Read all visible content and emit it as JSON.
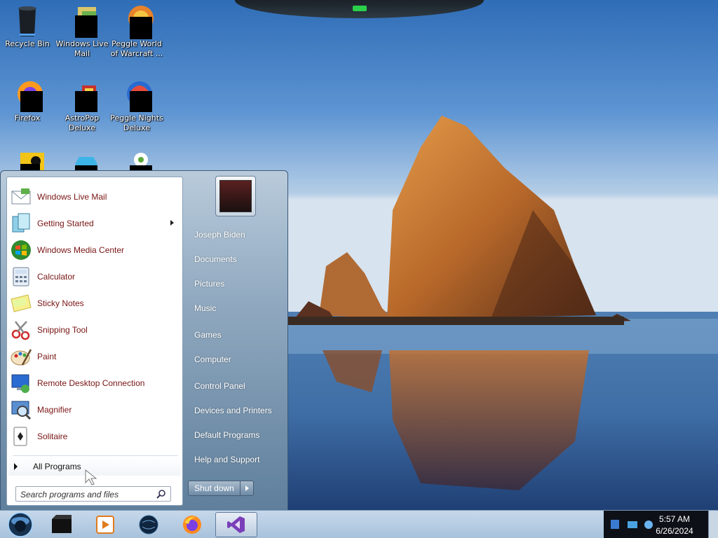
{
  "desktop": {
    "icons": [
      {
        "label": "Recycle Bin",
        "icon": "recycle-bin-icon"
      },
      {
        "label": "Windows Live Mail",
        "icon": "windows-live-mail-icon"
      },
      {
        "label": "Peggle World of Warcraft ...",
        "icon": "peggle-warcraft-icon"
      },
      {
        "label": "Firefox",
        "icon": "firefox-icon"
      },
      {
        "label": "AstroPop Deluxe",
        "icon": "astropop-icon"
      },
      {
        "label": "Peggle Nights Deluxe",
        "icon": "peggle-nights-icon"
      }
    ]
  },
  "start_menu": {
    "programs": [
      {
        "label": "Windows Live Mail",
        "icon": "mail-icon",
        "has_submenu": false
      },
      {
        "label": "Getting Started",
        "icon": "getting-started-icon",
        "has_submenu": true
      },
      {
        "label": "Windows Media Center",
        "icon": "media-center-icon",
        "has_submenu": false
      },
      {
        "label": "Calculator",
        "icon": "calculator-icon",
        "has_submenu": false
      },
      {
        "label": "Sticky Notes",
        "icon": "sticky-notes-icon",
        "has_submenu": false
      },
      {
        "label": "Snipping Tool",
        "icon": "snipping-tool-icon",
        "has_submenu": false
      },
      {
        "label": "Paint",
        "icon": "paint-icon",
        "has_submenu": false
      },
      {
        "label": "Remote Desktop Connection",
        "icon": "remote-desktop-icon",
        "has_submenu": false
      },
      {
        "label": "Magnifier",
        "icon": "magnifier-icon",
        "has_submenu": false
      },
      {
        "label": "Solitaire",
        "icon": "solitaire-icon",
        "has_submenu": false
      }
    ],
    "all_programs_label": "All Programs",
    "search_placeholder": "Search programs and files",
    "right_items": [
      "Joseph Biden",
      "Documents",
      "Pictures",
      "Music",
      "Games",
      "Computer",
      "Control Panel",
      "Devices and Printers",
      "Default Programs",
      "Help and Support"
    ],
    "shutdown_label": "Shut down"
  },
  "taskbar": {
    "pinned": [
      {
        "icon": "black-app-icon"
      },
      {
        "icon": "media-player-icon"
      },
      {
        "icon": "globe-icon"
      },
      {
        "icon": "firefox-icon"
      },
      {
        "icon": "visual-studio-icon"
      }
    ],
    "clock": {
      "time": "5:57 AM",
      "date": "6/26/2024"
    }
  },
  "colors": {
    "program_text": "#7a1515",
    "sky": "#3c7fc6",
    "tray": "#0d1117"
  }
}
